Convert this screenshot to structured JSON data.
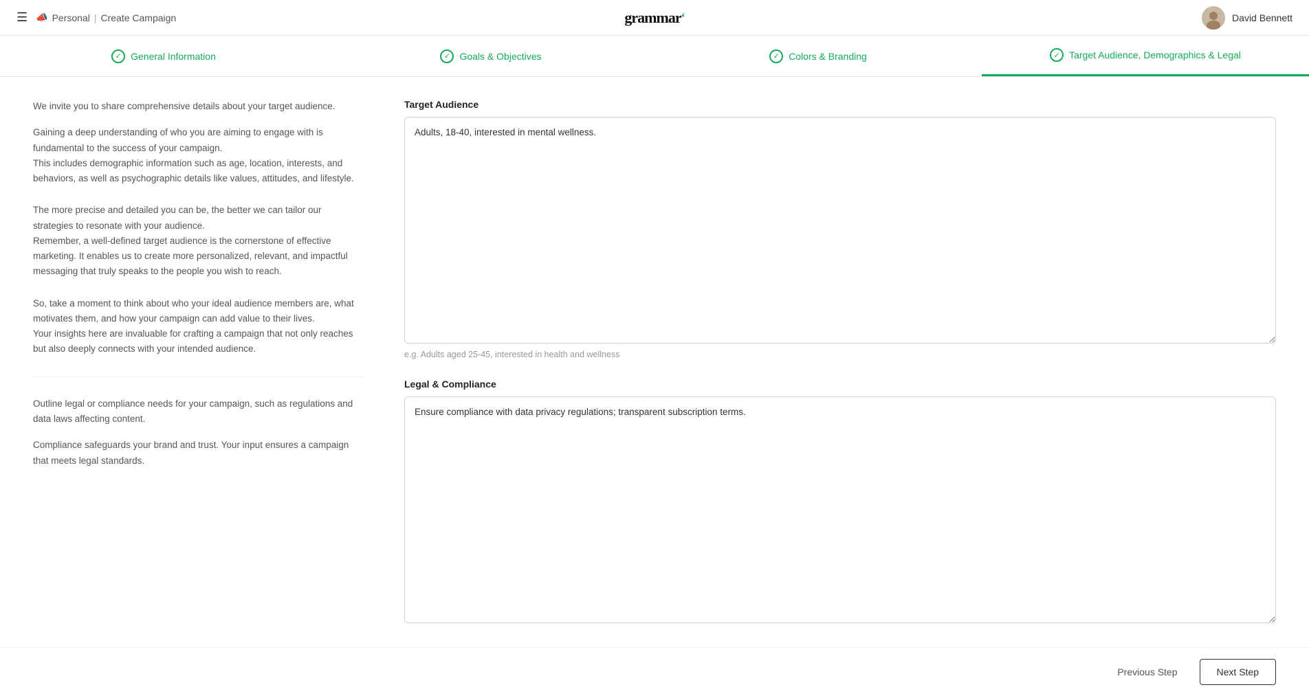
{
  "header": {
    "menu_icon": "☰",
    "megaphone_icon": "📣",
    "brand_name": "Personal",
    "separator": "|",
    "create_campaign_label": "Create Campaign",
    "logo_text": "grammar",
    "logo_mark": "ʻ",
    "user_name": "David Bennett",
    "avatar_icon": "👤"
  },
  "steps": [
    {
      "id": "general-info",
      "label": "General Information",
      "state": "completed"
    },
    {
      "id": "goals-objectives",
      "label": "Goals & Objectives",
      "state": "completed"
    },
    {
      "id": "colors-branding",
      "label": "Colors & Branding",
      "state": "completed"
    },
    {
      "id": "target-audience",
      "label": "Target Audience, Demographics & Legal",
      "state": "active"
    }
  ],
  "left_panel": {
    "target_audience_intro": "We invite you to share comprehensive details about your target audience.",
    "target_audience_p1": "Gaining a deep understanding of who you are aiming to engage with is fundamental to the success of your campaign.\nThis includes demographic information such as age, location, interests, and behaviors, as well as psychographic details like values, attitudes, and lifestyle.",
    "target_audience_p2": "The more precise and detailed you can be, the better we can tailor our strategies to resonate with your audience.\nRemember, a well-defined target audience is the cornerstone of effective marketing. It enables us to create more personalized, relevant, and impactful messaging that truly speaks to the people you wish to reach.",
    "target_audience_p3": "So, take a moment to think about who your ideal audience members are, what motivates them, and how your campaign can add value to their lives.\nYour insights here are invaluable for crafting a campaign that not only reaches but also deeply connects with your intended audience.",
    "legal_intro": "Outline legal or compliance needs for your campaign, such as regulations and data laws affecting content.",
    "legal_p1": "Compliance safeguards your brand and trust. Your input ensures a campaign that meets legal standards."
  },
  "right_panel": {
    "target_audience_label": "Target Audience",
    "target_audience_value": "Adults, 18-40, interested in mental wellness.",
    "target_audience_placeholder": "Adults, 18-40, interested in mental wellness.",
    "target_audience_hint": "e.g. Adults aged 25-45, interested in health and wellness",
    "legal_label": "Legal & Compliance",
    "legal_value": "Ensure compliance with data privacy regulations; transparent subscription terms.",
    "legal_placeholder": "Ensure compliance with data privacy regulations; transparent subscription terms."
  },
  "footer": {
    "prev_label": "Previous Step",
    "next_label": "Next Step"
  }
}
